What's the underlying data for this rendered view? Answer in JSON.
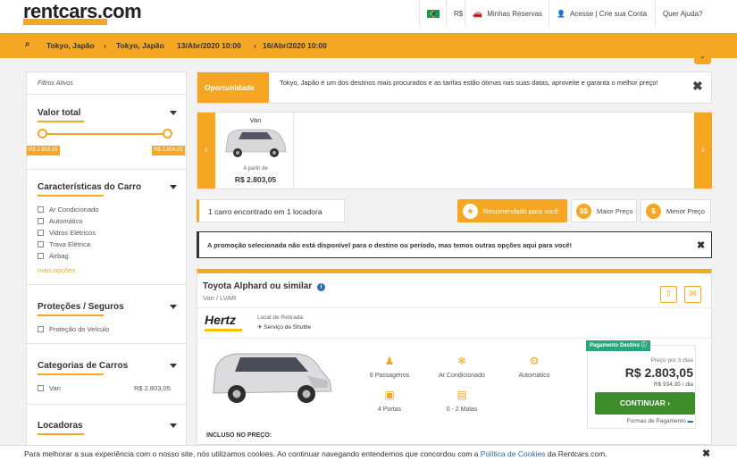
{
  "header": {
    "logo": "rentcars.com",
    "currency": "R$",
    "my_bookings": "Minhas Reservas",
    "account": "Acesse | Crie sua Conta",
    "help": "Quer Ajuda?"
  },
  "search": {
    "pickup_location": "Tokyo, Japão",
    "dropoff_location": "Tokyo, Japão",
    "pickup_date": "13/Abr/2020 10:00",
    "dropoff_date": "16/Abr/2020 10:00"
  },
  "sidebar": {
    "active_filters": "Filtros Ativos",
    "price_title": "Valor total",
    "price_min": "R$ 2.803,05",
    "price_max": "R$ 2.804,05",
    "features_title": "Características do Carro",
    "features": [
      "Ar Condicionado",
      "Automático",
      "Vidros Elétricos",
      "Trava Elétrica",
      "Airbag"
    ],
    "more_options": "mais opções",
    "protection_title": "Proteções / Seguros",
    "protection_items": [
      "Proteção do Veículo"
    ],
    "categories_title": "Categorias de Carros",
    "category_name": "Van",
    "category_price": "R$ 2.803,05",
    "companies_title": "Locadoras"
  },
  "opportunity": {
    "tag": "Oportunidade",
    "text": "Tokyo, Japão é um dos destinos mais procurados e as tarifas estão ótimas nas suas datas, aproveite e garanta o melhor preço!"
  },
  "carousel": {
    "category": "Van",
    "from_label": "A partir de",
    "price": "R$ 2.803,05"
  },
  "results": {
    "count_text": "1 carro encontrado em 1 locadora",
    "sort_recommended": "Recomendado para você",
    "sort_highest": "Maior Preço",
    "sort_lowest": "Menor Preço",
    "notice": "A promoção selecionada não está disponível para o destino ou período, mas temos outras opções aqui para você!"
  },
  "offer": {
    "title": "Toyota Alphard ou similar",
    "subtitle": "Van / LVAR",
    "company": "Hertz",
    "pickup_label": "Local de Retirada",
    "pickup_value": "Serviço de Shuttle",
    "features": [
      {
        "icon": "seat-icon",
        "label": "8 Passageiros"
      },
      {
        "icon": "snowflake-icon",
        "label": "Ar Condicionado"
      },
      {
        "icon": "gearshift-icon",
        "label": "Automático"
      },
      {
        "icon": "door-icon",
        "label": "4 Portas"
      },
      {
        "icon": "suitcase-icon",
        "label": "0 - 2 Malas"
      }
    ],
    "payment_badge": "Pagamento Destino",
    "price_period": "Preço por 3 dias",
    "price_total": "R$ 2.803,05",
    "price_daily": "R$ 934,35 / dia",
    "continue_label": "CONTINUAR",
    "payment_forms": "Formas de Pagamento",
    "included_label": "INCLUSO NO PREÇO:"
  },
  "cookie": {
    "text_before": "Para melhorar a sua experiência com o nosso site, nós utilizamos cookies. Ao continuar navegando entendemos que concordou com a ",
    "link": "Política de Cookies",
    "text_after": " da Rentcars.com."
  },
  "colors": {
    "brand_orange": "#f5a623",
    "continue_green": "#3c8c2a",
    "badge_teal": "#2aa57a",
    "link_orange": "#f5a623"
  }
}
